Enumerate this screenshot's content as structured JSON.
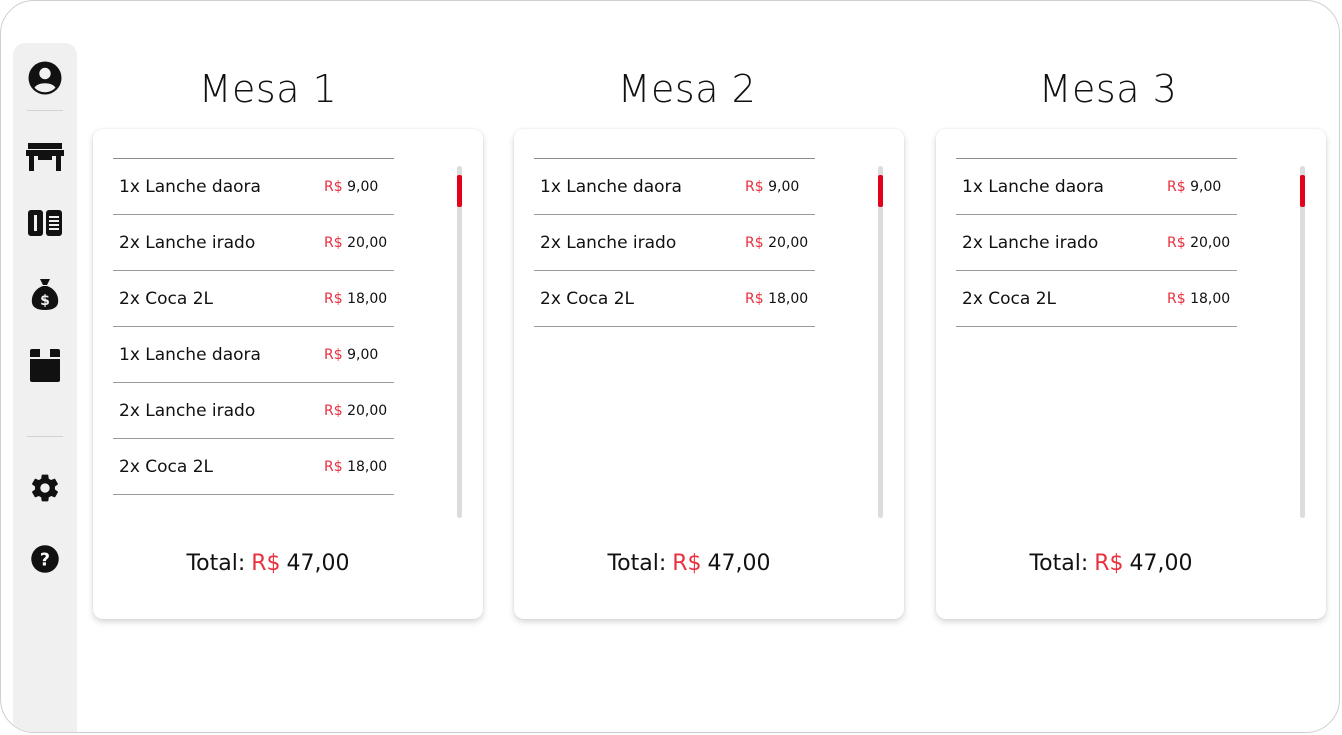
{
  "sidebar": {
    "top_items": [
      {
        "icon": "user-circle-icon"
      },
      {
        "icon": "store-icon"
      },
      {
        "icon": "menu-book-icon"
      },
      {
        "icon": "money-bag-icon"
      },
      {
        "icon": "box-icon"
      }
    ],
    "bottom_items": [
      {
        "icon": "gear-icon"
      },
      {
        "icon": "help-icon"
      }
    ]
  },
  "colors": {
    "accent": "#e8303e",
    "scroll_thumb": "#e3001b",
    "sidebar_bg": "#f0f0f0"
  },
  "tables": [
    {
      "title": "Mesa 1",
      "orders": [
        {
          "item": "1x Lanche daora",
          "currency": "R$",
          "price": "9,00"
        },
        {
          "item": "2x Lanche irado",
          "currency": "R$",
          "price": "20,00"
        },
        {
          "item": "2x Coca 2L",
          "currency": "R$",
          "price": "18,00"
        },
        {
          "item": "1x Lanche daora",
          "currency": "R$",
          "price": "9,00"
        },
        {
          "item": "2x Lanche irado",
          "currency": "R$",
          "price": "20,00"
        },
        {
          "item": "2x Coca 2L",
          "currency": "R$",
          "price": "18,00"
        }
      ],
      "total_label": "Total:",
      "total_currency": "R$",
      "total_value": "47,00"
    },
    {
      "title": "Mesa 2",
      "orders": [
        {
          "item": "1x Lanche daora",
          "currency": "R$",
          "price": "9,00"
        },
        {
          "item": "2x Lanche irado",
          "currency": "R$",
          "price": "20,00"
        },
        {
          "item": "2x Coca 2L",
          "currency": "R$",
          "price": "18,00"
        }
      ],
      "total_label": "Total:",
      "total_currency": "R$",
      "total_value": "47,00"
    },
    {
      "title": "Mesa 3",
      "orders": [
        {
          "item": "1x Lanche daora",
          "currency": "R$",
          "price": "9,00"
        },
        {
          "item": "2x Lanche irado",
          "currency": "R$",
          "price": "20,00"
        },
        {
          "item": "2x Coca 2L",
          "currency": "R$",
          "price": "18,00"
        }
      ],
      "total_label": "Total:",
      "total_currency": "R$",
      "total_value": "47,00"
    }
  ]
}
